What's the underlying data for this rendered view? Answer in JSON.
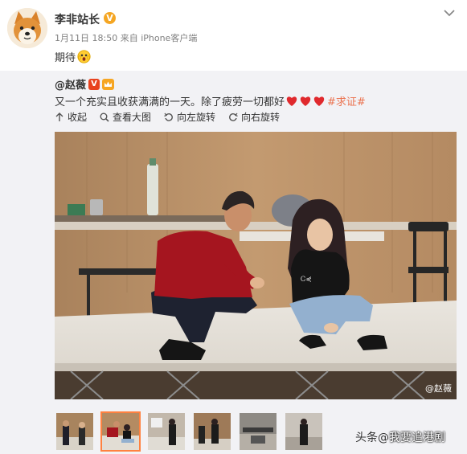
{
  "post": {
    "username": "李非站长",
    "verified_mark": "V",
    "time": "1月11日 18:50",
    "source": "来自 iPhone客户端",
    "text": "期待"
  },
  "repost": {
    "author": "@赵薇",
    "verified_mark": "V",
    "text": "又一个充实且收获满满的一天。除了疲劳一切都好",
    "hashtag": "#求证#",
    "actions": {
      "collapse": "收起",
      "view_large": "查看大图",
      "rotate_left": "向左旋转",
      "rotate_right": "向右旋转"
    },
    "photo_watermark": "@赵薇",
    "thumbnails_count": 6,
    "active_thumbnail": 2
  },
  "footer_watermark": {
    "prefix": "头条",
    "at": "@",
    "handle": "我要追港剧"
  },
  "colors": {
    "hashtag": "#eb7350",
    "verified_gold": "#f5a623",
    "verified_red": "#e8421e",
    "active_thumb_border": "#ff8140"
  }
}
